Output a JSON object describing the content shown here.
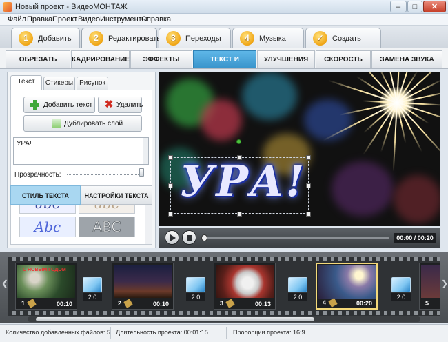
{
  "window": {
    "title": "Новый проект - ВидеоМОНТАЖ",
    "minimize": "–",
    "maximize": "□",
    "close": "✕"
  },
  "menu": [
    "Файл",
    "Правка",
    "Проект",
    "Видео",
    "Инструменты",
    "Справка"
  ],
  "steps": [
    {
      "num": "1",
      "label": "Добавить"
    },
    {
      "num": "2",
      "label": "Редактировать",
      "active": true
    },
    {
      "num": "3",
      "label": "Переходы"
    },
    {
      "num": "4",
      "label": "Музыка"
    },
    {
      "num": "✓",
      "label": "Создать"
    }
  ],
  "subtabs": [
    "ОБРЕЗАТЬ ВИДЕО",
    "КАДРИРОВАНИЕ",
    "ЭФФЕКТЫ",
    "ТЕКСТ И ГРАФИКА",
    "УЛУЧШЕНИЯ",
    "СКОРОСТЬ",
    "ЗАМЕНА ЗВУКА"
  ],
  "active_subtab": "ТЕКСТ И ГРАФИКА",
  "panel": {
    "tabs": [
      "Текст",
      "Стикеры",
      "Рисунок"
    ],
    "add_text": "Добавить текст",
    "delete": "Удалить",
    "duplicate": "Дублировать слой",
    "text_value": "УРА!",
    "transparency_label": "Прозрачность:",
    "style_tabs": [
      "СТИЛЬ ТЕКСТА",
      "НАСТРОЙКИ ТЕКСТА"
    ],
    "style_samples": [
      "Abc",
      "ABC"
    ]
  },
  "preview": {
    "overlay_text": "УРА!"
  },
  "player": {
    "time": "00:00 / 00:20"
  },
  "timeline": {
    "clips": [
      {
        "num": "1",
        "duration": "00:10",
        "caption": "С НОВЫМ ГОДОМ"
      },
      {
        "num": "2",
        "duration": "00:10"
      },
      {
        "num": "3",
        "duration": "00:13"
      },
      {
        "num": "4",
        "duration": "00:20",
        "selected": true
      },
      {
        "num": "5",
        "duration": ""
      }
    ],
    "transition_value": "2.0"
  },
  "status": {
    "files": "Количество добавленных файлов: 5",
    "duration": "Длительность проекта:  00:01:15",
    "ratio": "Пропорции проекта:   16:9"
  },
  "colors": {
    "accent": "#3a95cc",
    "step_badge": "#f0a616",
    "selected_clip": "#f4d97a"
  }
}
